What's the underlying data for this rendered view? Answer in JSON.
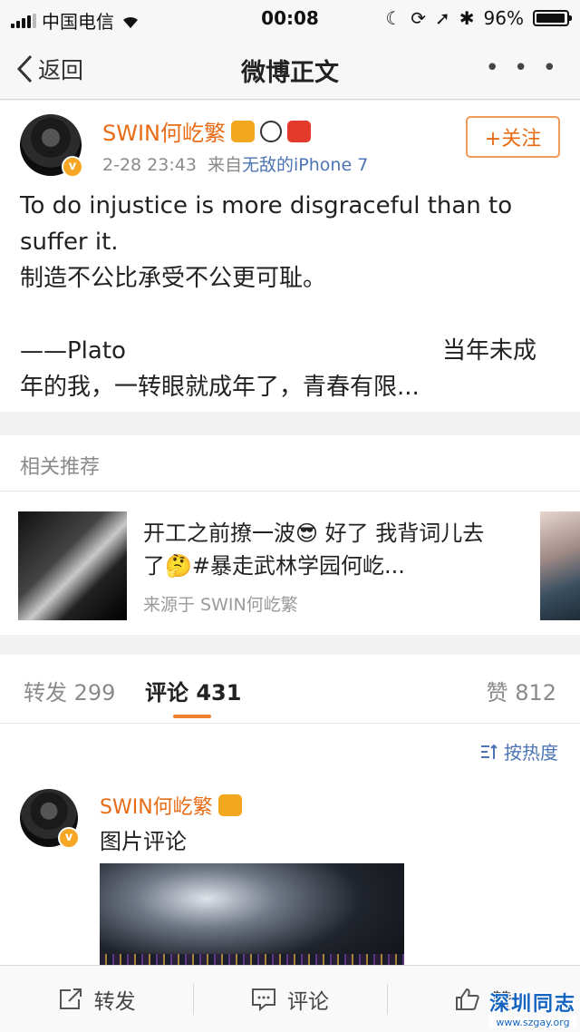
{
  "status_bar": {
    "carrier": "中国电信",
    "time": "00:08",
    "battery_text": "96%",
    "battery_level": 0.96
  },
  "nav": {
    "back_label": "返回",
    "title": "微博正文",
    "more_label": "• • •"
  },
  "post": {
    "author": "SWIN何屹繁",
    "date": "2-28 23:43",
    "source_prefix": "来自",
    "source": "无敌的iPhone 7",
    "follow_label": "+关注",
    "lines": [
      "To do injustice is more disgraceful than to",
      "suffer it.",
      "制造不公比承受不公更可耻。",
      "",
      "——Plato",
      "年的我，一转眼就成年了，青春有限..."
    ],
    "line5_right": "当年未成"
  },
  "related": {
    "heading": "相关推荐",
    "text": "开工之前撩一波😎 好了 我背词儿去了🤔#暴走武林学园何屹...",
    "source": "来源于 SWIN何屹繁"
  },
  "tabs": {
    "repost_label": "转发",
    "repost_count": "299",
    "comment_label": "评论",
    "comment_count": "431",
    "like_label": "赞",
    "like_count": "812"
  },
  "comments": {
    "sort_label": "按热度",
    "first": {
      "author": "SWIN何屹繁",
      "text": "图片评论"
    }
  },
  "toolbar": {
    "repost": "转发",
    "comment": "评论",
    "like": "赞"
  },
  "watermark": {
    "title": "深圳同志",
    "url": "www.szgay.org"
  },
  "colors": {
    "accent_orange": "#e86b15",
    "link_blue": "#4c74b5",
    "verified_badge": "#f5a623"
  }
}
